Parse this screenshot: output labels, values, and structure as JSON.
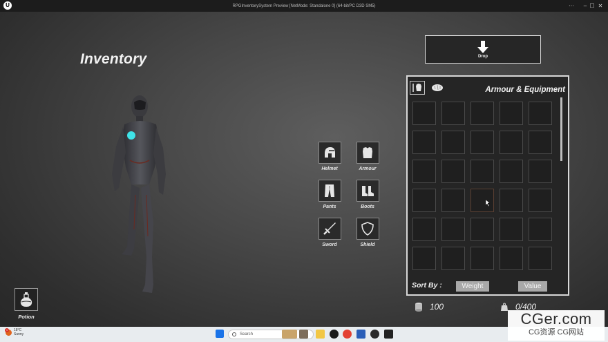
{
  "window": {
    "title": "RPGInventorySystem Preview [NetMode: Standalone 0]  (64-bit/PC D3D SM5)",
    "logo": "U",
    "controls": [
      "⋯",
      "–",
      "☐",
      "✕"
    ]
  },
  "inventory": {
    "title": "Inventory"
  },
  "drop_button": {
    "label": "Drop",
    "icon": "arrow-down-icon"
  },
  "equipment_slots": [
    {
      "label": "Helmet",
      "icon": "helmet-icon"
    },
    {
      "label": "Armour",
      "icon": "armour-icon"
    },
    {
      "label": "Pants",
      "icon": "pants-icon"
    },
    {
      "label": "Boots",
      "icon": "boots-icon"
    },
    {
      "label": "Sword",
      "icon": "sword-icon"
    },
    {
      "label": "Shield",
      "icon": "shield-icon"
    }
  ],
  "panel": {
    "heading": "Armour & Equipment",
    "tabs": [
      {
        "icon": "equipment-tab-icon",
        "active": true
      },
      {
        "icon": "food-tab-icon",
        "active": false
      }
    ],
    "grid": {
      "columns": 5,
      "visible_rows": 6,
      "hovered_cell": {
        "row": 4,
        "col": 3
      }
    },
    "sort_label": "Sort By :",
    "sort_options": [
      "Weight",
      "Value"
    ]
  },
  "stats": {
    "gold": "100",
    "weight": "0/400"
  },
  "quick_slot": {
    "label": "Potion",
    "icon": "potion-icon"
  },
  "taskbar": {
    "weather_temp": "18°C",
    "weather_desc": "Sunny",
    "weather_badge": "1",
    "search_placeholder": "Search"
  },
  "watermark": {
    "line1": "CGer.com",
    "line2": "CG资源 CG网站"
  },
  "colors": {
    "panel_border": "#d8d8d8",
    "panel_bg": "#252525",
    "sort_button": "#a9a9a9",
    "cell_border": "#4a4a4a",
    "hover_cell_border": "#5a3f32",
    "suit_accent": "#3fe3e8"
  }
}
